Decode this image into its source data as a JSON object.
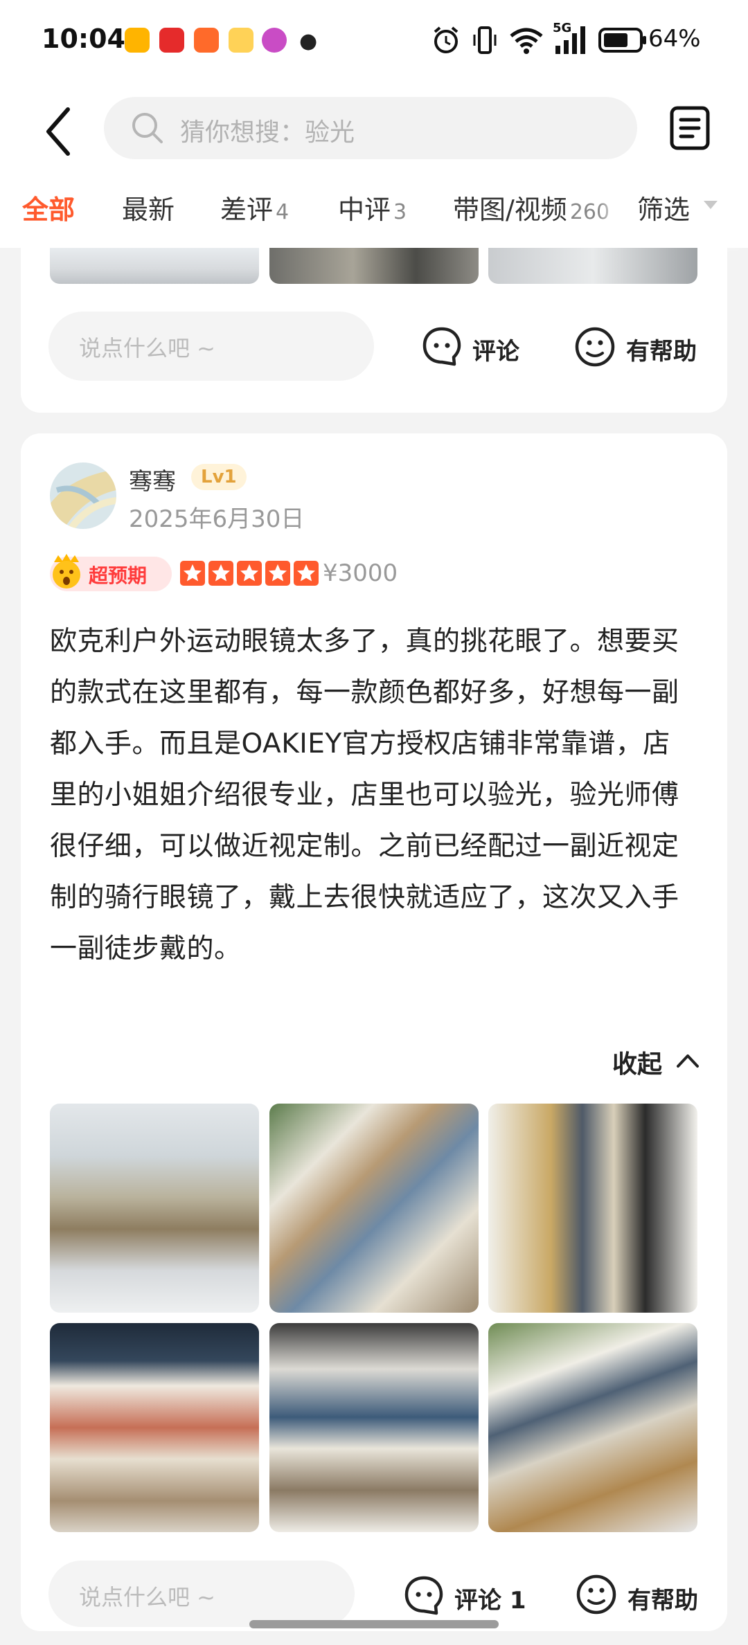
{
  "status_bar": {
    "time": "10:04",
    "network": "5G",
    "battery": "64%"
  },
  "header": {
    "search_placeholder": "猜你想搜：验光"
  },
  "tabs": [
    {
      "label": "全部",
      "count": ""
    },
    {
      "label": "最新",
      "count": ""
    },
    {
      "label": "差评",
      "count": "4"
    },
    {
      "label": "中评",
      "count": "3"
    },
    {
      "label": "带图/视频",
      "count": "260"
    }
  ],
  "filter": {
    "label": "筛选"
  },
  "prev_card": {
    "comment_placeholder": "说点什么吧 ~",
    "comment_label": "评论",
    "helpful_label": "有帮助"
  },
  "review": {
    "username": "骞骞",
    "level": "Lv1",
    "date": "2025年6月30日",
    "badge": "超预期",
    "rating": 5,
    "price": "¥3000",
    "text": "欧克利户外运动眼镜太多了，真的挑花眼了。想要买的款式在这里都有，每一款颜色都好多，好想每一副都入手。而且是OAKIEY官方授权店铺非常靠谱，店里的小姐姐介绍很专业，店里也可以验光，验光师傅很仔细，可以做近视定制。之前已经配过一副近视定制的骑行眼镜了，戴上去很快就适应了，这次又入手一副徒步戴的。",
    "collapse_label": "收起",
    "comment_placeholder": "说点什么吧 ~",
    "comment_label": "评论 1",
    "helpful_label": "有帮助"
  },
  "colors": {
    "accent": "#ff5a2d",
    "badge_text": "#ff3b3b",
    "level_text": "#e3a23b"
  }
}
